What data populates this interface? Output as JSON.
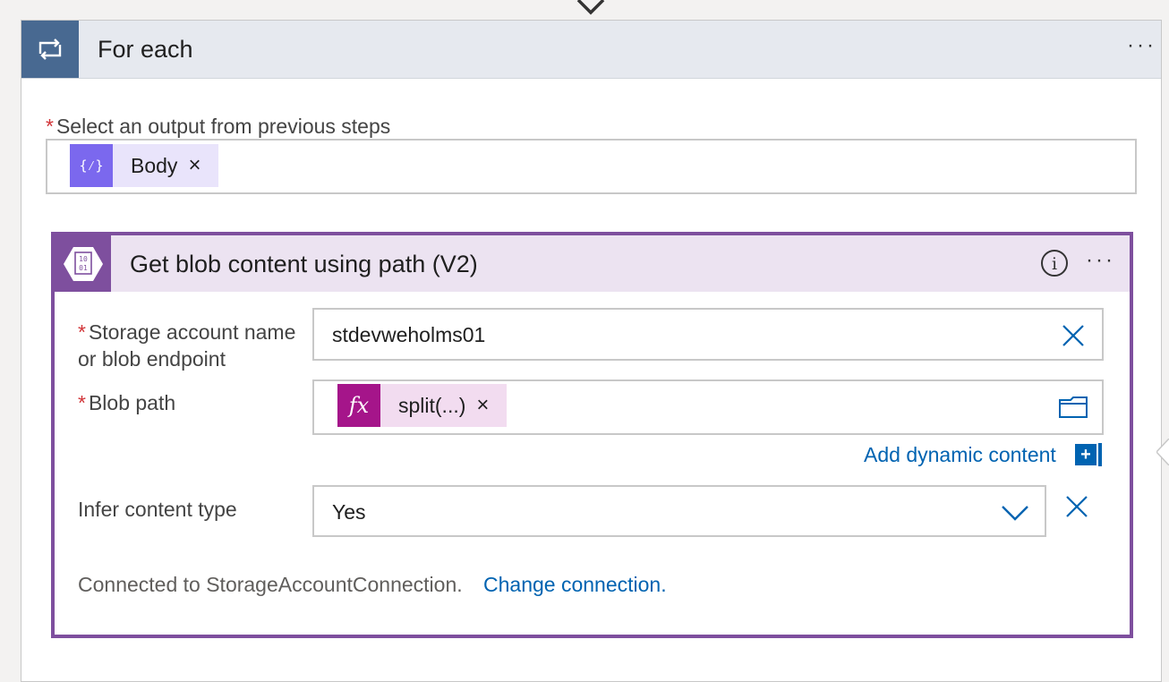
{
  "for_each": {
    "title": "For each",
    "more_label": "···",
    "output_field": {
      "label": "Select an output from previous steps",
      "required_mark": "*",
      "token": {
        "label": "Body",
        "remove_label": "×",
        "icon": "expression-braces-icon"
      }
    }
  },
  "action": {
    "title": "Get blob content using path (V2)",
    "info_label": "i",
    "more_label": "···",
    "icon_text_top": "10",
    "icon_text_bottom": "01",
    "fields": {
      "storage": {
        "required_mark": "*",
        "label_line1": "Storage account name",
        "label_line2": "or blob endpoint",
        "value": "stdevweholms01"
      },
      "blob_path": {
        "required_mark": "*",
        "label": "Blob path",
        "token": {
          "icon_label": "fx",
          "label": "split(...)",
          "remove_label": "×"
        }
      },
      "infer": {
        "label": "Infer content type",
        "value": "Yes"
      }
    },
    "add_dynamic_label": "Add dynamic content",
    "add_dynamic_plus": "+",
    "connection": {
      "text": "Connected to StorageAccountConnection.",
      "change_label": "Change connection."
    }
  },
  "colors": {
    "foreach_accent": "#486991",
    "action_accent": "#7e4f9e",
    "link": "#0063b1",
    "required": "#d13438"
  }
}
